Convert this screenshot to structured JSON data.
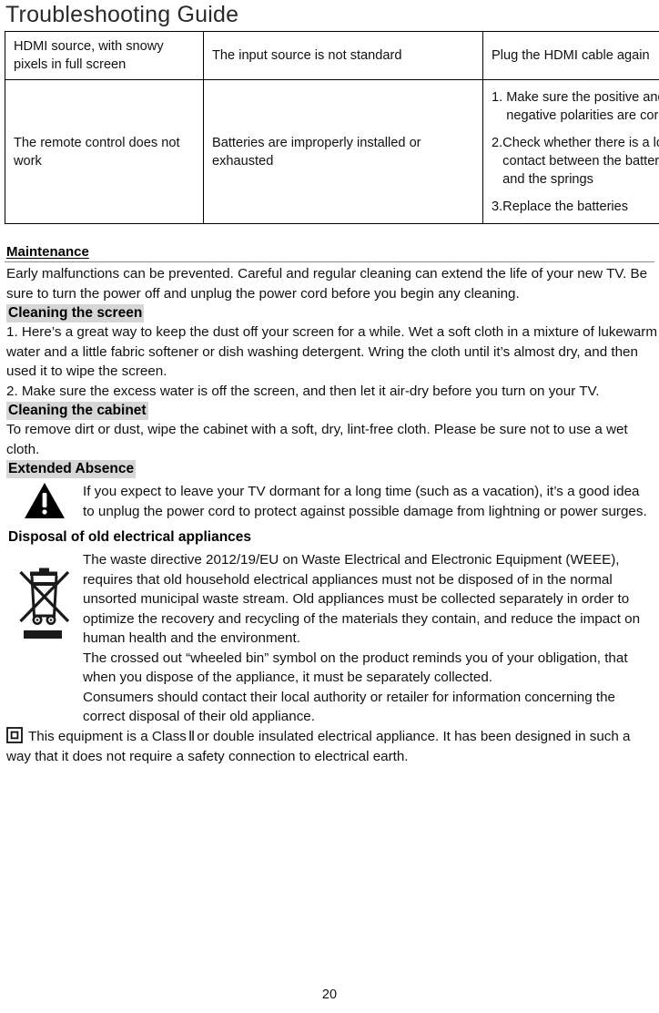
{
  "document": {
    "title": "Troubleshooting Guide",
    "page_number": "20"
  },
  "troubleshooting_table": {
    "rows": [
      {
        "symptom": "HDMI source, with snowy pixels in full screen",
        "cause": "The input source is not standard",
        "solution": "Plug the HDMI cable again"
      },
      {
        "symptom": "The remote control does not work",
        "cause": "Batteries are improperly installed or exhausted",
        "solution_steps": [
          {
            "num": "1. ",
            "text": "Make sure the positive and the negative polarities are correct."
          },
          {
            "num": "2.",
            "text": "Check whether there is a loose contact between the batteries and the springs"
          },
          {
            "num": "3.",
            "text": "Replace the batteries"
          }
        ]
      }
    ]
  },
  "maintenance": {
    "heading": "Maintenance",
    "intro": "Early malfunctions can be prevented. Careful and regular cleaning can extend the life of your new TV. Be sure to turn the power off and unplug the power cord before you begin any cleaning.",
    "cleaning_screen": {
      "heading": "Cleaning the screen",
      "step1": "1. Here’s a great way to keep the dust off your screen for a while. Wet a soft cloth in a mixture of lukewarm water and a little fabric softener or dish washing detergent. Wring the cloth until it’s almost dry, and then used it to wipe the screen.",
      "step2": "2. Make sure the excess water is off the screen, and then let it air-dry before you turn on your TV."
    },
    "cleaning_cabinet": {
      "heading": "Cleaning the cabinet",
      "text": "To remove dirt or dust, wipe the cabinet with a soft, dry, lint-free cloth. Please be sure not to use a wet cloth."
    },
    "extended_absence": {
      "heading": "Extended Absence",
      "icon": "warning-triangle-icon",
      "text": "If you expect to leave your TV dormant for a long time (such as a vacation), it’s a good idea to unplug the power cord to protect against possible damage from lightning or power surges."
    }
  },
  "disposal": {
    "heading": "Disposal of old electrical appliances",
    "icon": "crossed-out-wheeled-bin-icon",
    "paragraph1": "The waste directive 2012/19/EU on Waste Electrical and Electronic Equipment (WEEE), requires that old household electrical appliances must not be disposed of in the normal unsorted municipal waste stream. Old appliances must be collected separately in order to optimize the recovery and recycling of the materials they contain, and reduce the impact on human health and the environment.",
    "paragraph2": "The crossed out “wheeled bin” symbol on the product reminds you of your obligation, that when you dispose of the appliance, it must be separately collected.",
    "paragraph3": "Consumers should contact their local authority or retailer for information concerning the correct disposal of their old appliance."
  },
  "class_ii": {
    "icon": "class-2-double-insulated-icon",
    "text_before": "This equipment is a Class",
    "roman_numeral": "Ⅱ",
    "text_after": "or double insulated electrical appliance. It has been designed in such a way that it does not require a safety connection to electrical earth."
  },
  "colors": {
    "highlight": "#d6d6d6",
    "rule": "#8c8c8c",
    "text": "#111111"
  }
}
